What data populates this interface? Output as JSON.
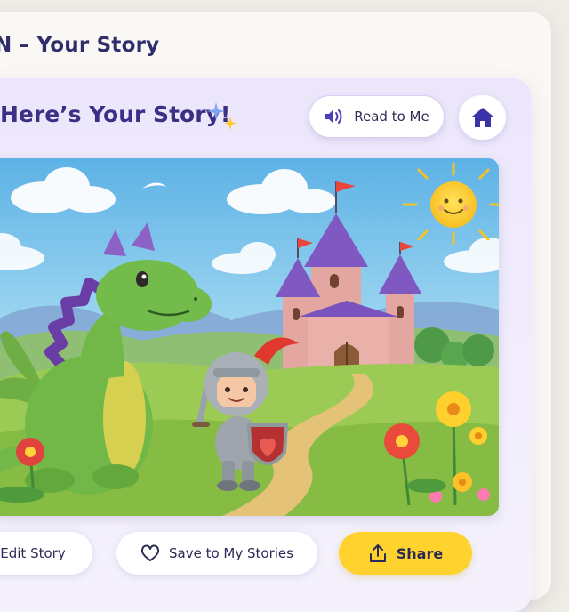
{
  "app": {
    "title": "N – Your Story"
  },
  "story": {
    "heading": "Here’s Your Story!"
  },
  "header_actions": {
    "read_label": "Read to Me",
    "read_icon": "speaker-icon",
    "home_icon": "home-icon"
  },
  "illustration": {
    "icon": "storybook-illustration",
    "subjects": [
      "dragon",
      "knight",
      "castle",
      "sun",
      "flowers"
    ]
  },
  "actions": {
    "edit_label": "Edit Story",
    "save_label": "Save to My Stories",
    "save_icon": "heart-icon",
    "share_label": "Share",
    "share_icon": "share-icon"
  },
  "colors": {
    "accent": "#3b2f86",
    "share_button": "#ffd22e",
    "panel": "#ece6fb"
  }
}
